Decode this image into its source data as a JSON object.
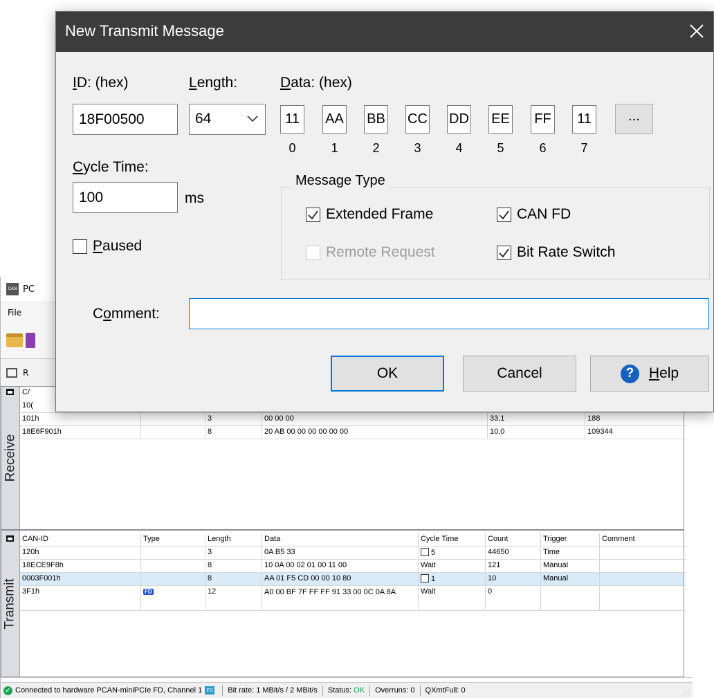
{
  "app": {
    "title": "PC",
    "menu_file": "File",
    "panel_tab": "R",
    "receive_label": "Receive",
    "transmit_label": "Transmit"
  },
  "receive": {
    "header_partial": "C/",
    "row0_partial": "10(",
    "rows": [
      {
        "id": "101h",
        "type": "",
        "length": "3",
        "data": "00 00 00",
        "cycle": "33,1",
        "count": "188"
      },
      {
        "id": "18E6F901h",
        "type": "",
        "length": "8",
        "data": "20 AB 00 00 00 00 00 00",
        "cycle": "10,0",
        "count": "109344"
      }
    ]
  },
  "transmit": {
    "columns": {
      "id": "CAN-ID",
      "type": "Type",
      "length": "Length",
      "data": "Data",
      "cycle": "Cycle Time",
      "count": "Count",
      "trigger": "Trigger",
      "comment": "Comment"
    },
    "rows": [
      {
        "id": "120h",
        "length": "3",
        "data": "0A B5 33",
        "cycle": "5",
        "count": "44650",
        "trigger": "Time"
      },
      {
        "id": "18ECE9F8h",
        "length": "8",
        "data": "10 0A 00 02 01 00 11 00",
        "cycle": "Wait",
        "count": "121",
        "trigger": "Manual"
      },
      {
        "id": "0003F001h",
        "length": "8",
        "data": "AA 01 F5 CD 00 00 10 80",
        "cycle": "1",
        "count": "10",
        "trigger": "Manual"
      },
      {
        "id": "3F1h",
        "type_badge": "FD",
        "length": "12",
        "data": "A0 00 BF 7F FF FF 91 33 00 0C 0A 8A",
        "cycle": "Wait",
        "count": "0",
        "trigger": ""
      }
    ]
  },
  "status": {
    "connection": "Connected to hardware PCAN-miniPCIe FD, Channel 1",
    "hw_icon": "FD",
    "bitrate": "Bit rate: 1 MBit/s / 2 MBit/s",
    "status_label": "Status:",
    "status_value": "OK",
    "overruns": "Overruns: 0",
    "qxmtfull": "QXmtFull: 0"
  },
  "dialog": {
    "title": "New Transmit Message",
    "id_label_u": "I",
    "id_label_rest": "D: (hex)",
    "id_value": "18F00500",
    "length_label_u": "L",
    "length_label_rest": "ength:",
    "length_value": "64",
    "data_label_u": "D",
    "data_label_rest": "ata: (hex)",
    "data_bytes": [
      "11",
      "AA",
      "BB",
      "CC",
      "DD",
      "EE",
      "FF",
      "11"
    ],
    "byte_indices": [
      "0",
      "1",
      "2",
      "3",
      "4",
      "5",
      "6",
      "7"
    ],
    "more_button": "...",
    "cycle_label_u": "C",
    "cycle_label_rest": "ycle Time:",
    "cycle_value": "100",
    "cycle_unit": "ms",
    "paused_u": "P",
    "paused_rest": "aused",
    "paused_checked": false,
    "message_type_legend": "Message Type",
    "extended_frame": "Extended Frame",
    "extended_frame_checked": true,
    "can_fd": "CAN FD",
    "can_fd_checked": true,
    "remote_request": "Remote Request",
    "remote_request_checked": false,
    "remote_request_enabled": false,
    "bit_rate_switch": "Bit Rate Switch",
    "bit_rate_switch_checked": true,
    "comment_label_a": "C",
    "comment_label_u": "o",
    "comment_label_rest": "mment:",
    "comment_value": "",
    "ok_button": "OK",
    "cancel_button": "Cancel",
    "help_u": "H",
    "help_rest": "elp"
  },
  "colors": {
    "dialog_title_bg": "#3c3c3c",
    "ok_border": "#0078d7",
    "selected_row": "#d9eaf9",
    "side_panel": "#dcdde3",
    "status_ok": "#1fa35a"
  }
}
